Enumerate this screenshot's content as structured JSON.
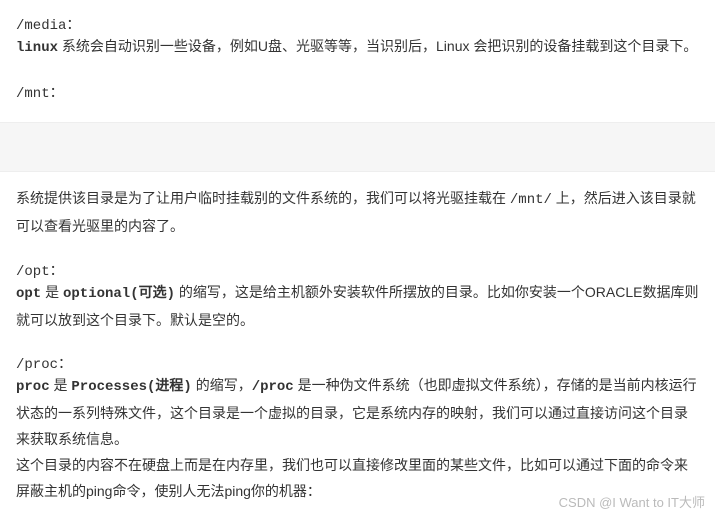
{
  "top": {
    "media_heading": "/media：",
    "media_line1_kw": "linux",
    "media_line1_rest": " 系统会自动识别一些设备，例如U盘、光驱等等，当识别后，Linux 会把识别的设备挂载到这个目录下。",
    "mnt_heading": "/mnt："
  },
  "bottom": {
    "mnt_desc_pre": "系统提供该目录是为了让用户临时挂载别的文件系统的，我们可以将光驱挂载在 ",
    "mnt_desc_code": "/mnt/",
    "mnt_desc_post": " 上，然后进入该目录就可以查看光驱里的内容了。",
    "opt_heading": "/opt：",
    "opt_kw1": "opt",
    "opt_txt1": " 是 ",
    "opt_kw2": "optional(可选)",
    "opt_txt2": " 的缩写，这是给主机额外安装软件所摆放的目录。比如你安装一个ORACLE数据库则就可以放到这个目录下。默认是空的。",
    "proc_heading": "/proc：",
    "proc_kw1": "proc",
    "proc_txt1": " 是 ",
    "proc_kw2": "Processes(进程)",
    "proc_txt2": " 的缩写，",
    "proc_kw3": "/proc",
    "proc_txt3": " 是一种伪文件系统（也即虚拟文件系统），存储的是当前内核运行状态的一系列特殊文件，这个目录是一个虚拟的目录，它是系统内存的映射，我们可以通过直接访问这个目录来获取系统信息。",
    "proc_para2": "这个目录的内容不在硬盘上而是在内存里，我们也可以直接修改里面的某些文件，比如可以通过下面的命令来屏蔽主机的ping命令，使别人无法ping你的机器："
  },
  "watermark": "CSDN @I Want to IT大师"
}
